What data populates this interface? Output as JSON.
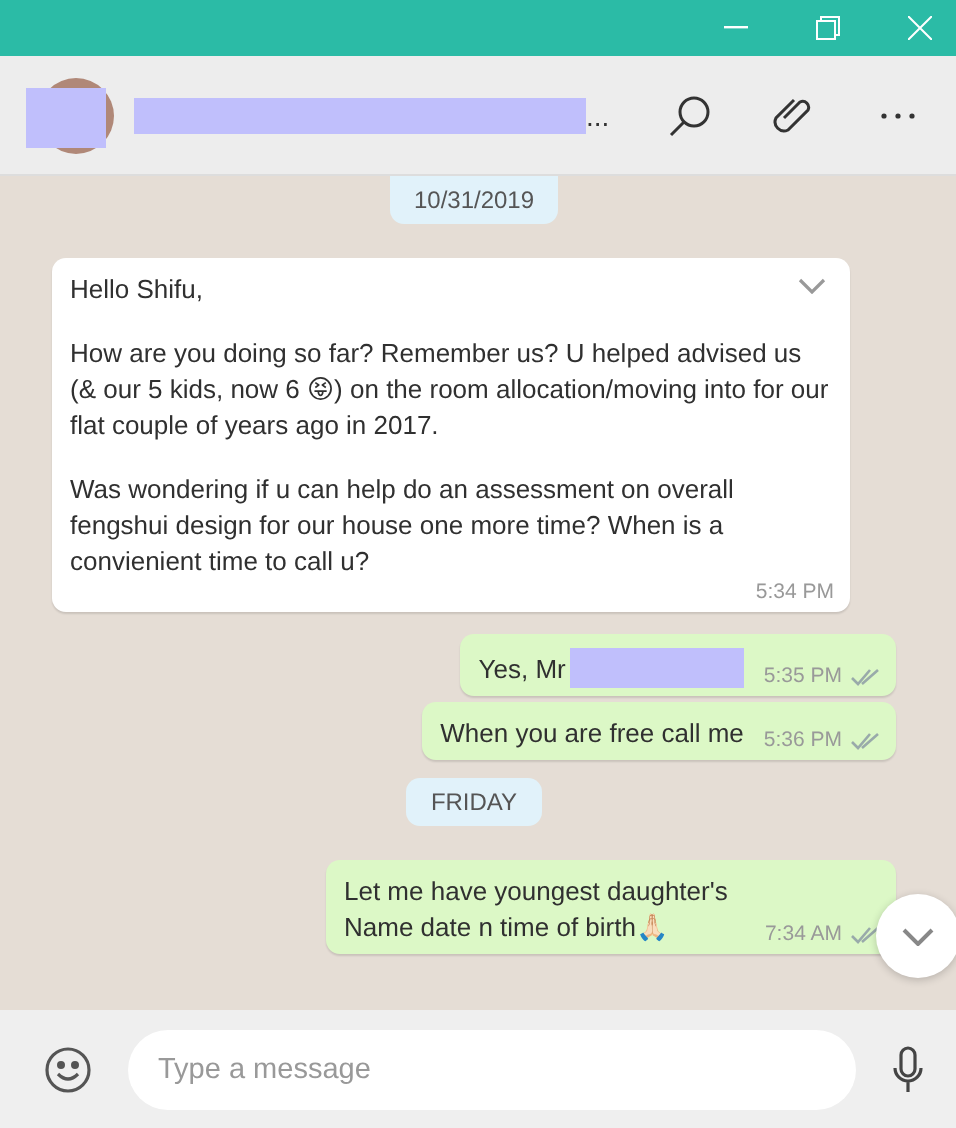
{
  "header": {
    "title_tail": "..."
  },
  "messages": [
    {
      "kind": "date",
      "text": "10/31/2019"
    },
    {
      "kind": "incoming",
      "paragraphs": [
        "Hello Shifu,",
        "How are you doing so far? Remember us? U helped advised us (& our 5 kids, now 6 😝) on the room allocation/moving into for our flat couple of years ago in 2017.",
        "Was wondering if u can help do an assessment on overall fengshui design for our house one more time? When is a convienient time to call u?"
      ],
      "time": "5:34 PM"
    },
    {
      "kind": "outgoing",
      "paragraphs": [
        "Yes, Mr"
      ],
      "redacted": true,
      "time": "5:35 PM",
      "delivered": true
    },
    {
      "kind": "outgoing",
      "paragraphs": [
        "When you are free call me"
      ],
      "redacted": false,
      "time": "5:36 PM",
      "delivered": true
    },
    {
      "kind": "date",
      "text": "FRIDAY"
    },
    {
      "kind": "outgoing",
      "paragraphs": [
        "Let me have youngest daughter's Name date n time of birth🙏🏻"
      ],
      "redacted": false,
      "time": "7:34 AM",
      "delivered": true
    }
  ],
  "composer": {
    "placeholder": "Type a message"
  }
}
